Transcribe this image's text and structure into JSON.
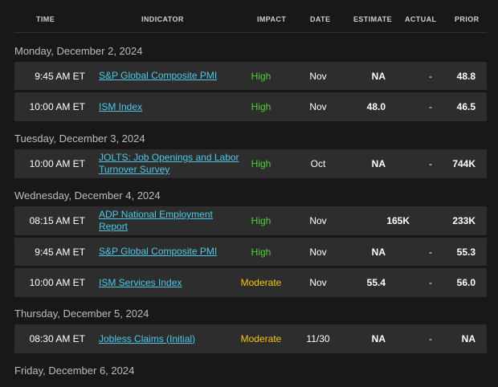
{
  "columns": {
    "time": "TIME",
    "indicator": "INDICATOR",
    "impact": "IMPACT",
    "date": "DATE",
    "estimate": "ESTIMATE",
    "actual": "ACTUAL",
    "prior": "PRIOR"
  },
  "colors": {
    "high": "#4cd137",
    "moderate": "#f5c518",
    "link": "#4fc8e8",
    "row_bg": "#2d2d2d",
    "page_bg": "#181818"
  },
  "days": [
    {
      "heading": "Monday, December 2, 2024",
      "events": [
        {
          "time": "9:45 AM ET",
          "indicator": "S&P Global Composite PMI",
          "impact": "High",
          "date": "Nov",
          "estimate": "NA",
          "actual": "-",
          "prior": "48.8"
        },
        {
          "time": "10:00 AM ET",
          "indicator": "ISM Index",
          "impact": "High",
          "date": "Nov",
          "estimate": "48.0",
          "actual": "-",
          "prior": "46.5"
        }
      ]
    },
    {
      "heading": "Tuesday, December 3, 2024",
      "events": [
        {
          "time": "10:00 AM ET",
          "indicator": "JOLTS: Job Openings and Labor Turnover Survey",
          "impact": "High",
          "date": "Oct",
          "estimate": "NA",
          "actual": "-",
          "prior": "744K"
        }
      ]
    },
    {
      "heading": "Wednesday, December 4, 2024",
      "events": [
        {
          "time": "08:15 AM ET",
          "indicator": "ADP National Employment Report",
          "impact": "High",
          "date": "Nov",
          "estimate": "",
          "actual": "165K",
          "prior": "233K"
        },
        {
          "time": "9:45 AM ET",
          "indicator": "S&P Global Composite PMI",
          "impact": "High",
          "date": "Nov",
          "estimate": "NA",
          "actual": "-",
          "prior": "55.3"
        },
        {
          "time": "10:00 AM ET",
          "indicator": "ISM Services Index",
          "impact": "Moderate",
          "date": "Nov",
          "estimate": "55.4",
          "actual": "-",
          "prior": "56.0"
        }
      ]
    },
    {
      "heading": "Thursday, December 5, 2024",
      "events": [
        {
          "time": "08:30 AM ET",
          "indicator": "Jobless Claims (Initial)",
          "impact": "Moderate",
          "date": "11/30",
          "estimate": "NA",
          "actual": "-",
          "prior": "NA"
        }
      ]
    },
    {
      "heading": "Friday, December 6, 2024",
      "events": []
    }
  ]
}
